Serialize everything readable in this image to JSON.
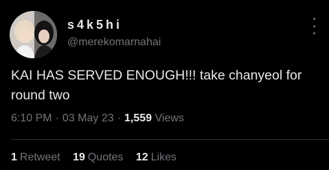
{
  "author": {
    "display_name": "s4k5hi",
    "handle": "@merekomarnahai",
    "avatar_icon": "profile-photo"
  },
  "more_icon": "more-options-icon",
  "tweet": {
    "text": "KAI HAS SERVED ENOUGH!!! take chanyeol for round two"
  },
  "meta": {
    "time": "6:10 PM",
    "separator": "·",
    "date": "03 May 23",
    "views_count": "1,559",
    "views_label": "Views"
  },
  "stats": {
    "retweets_count": "1",
    "retweets_label": "Retweet",
    "quotes_count": "19",
    "quotes_label": "Quotes",
    "likes_count": "12",
    "likes_label": "Likes"
  },
  "colors": {
    "background": "#000000",
    "text_primary": "#e7e9ea",
    "text_secondary": "#71767b",
    "divider": "#2f3336"
  }
}
